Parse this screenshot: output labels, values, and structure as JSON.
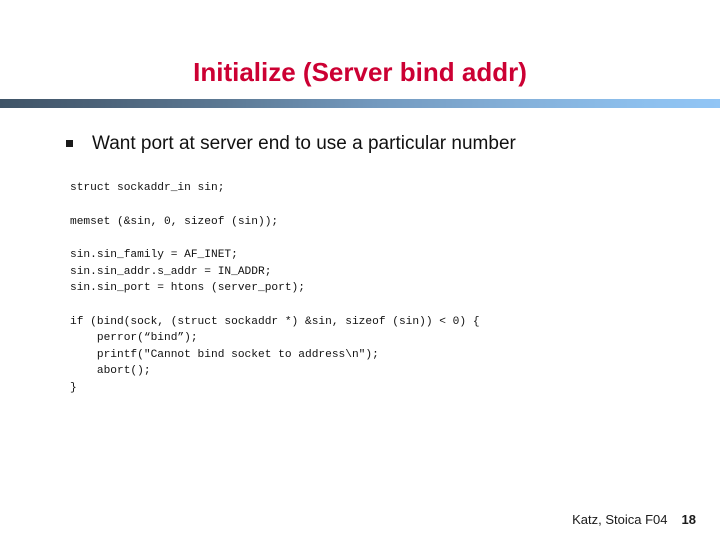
{
  "slide": {
    "title": "Initialize (Server bind addr)",
    "title_color": "#cc0033",
    "rule": {
      "color_start": "#3f5467",
      "color_end": "#91c5f5"
    },
    "bullet": {
      "marker": "square-bullet",
      "text": "Want port at server end to use a particular number"
    },
    "code_blocks": [
      {
        "lines": [
          "struct sockaddr_in sin;"
        ]
      },
      {
        "lines": [
          "memset (&sin, 0, sizeof (sin));"
        ]
      },
      {
        "lines": [
          "sin.sin_family = AF_INET;",
          "sin.sin_addr.s_addr = IN_ADDR;",
          "sin.sin_port = htons (server_port);"
        ]
      },
      {
        "lines": [
          "if (bind(sock, (struct sockaddr *) &sin, sizeof (sin)) < 0) {",
          "    perror(“bind”);",
          "    printf(\"Cannot bind socket to address\\n\");",
          "    abort();",
          "}"
        ]
      }
    ],
    "footer": {
      "credit": "Katz, Stoica F04",
      "page_number": "18"
    }
  }
}
